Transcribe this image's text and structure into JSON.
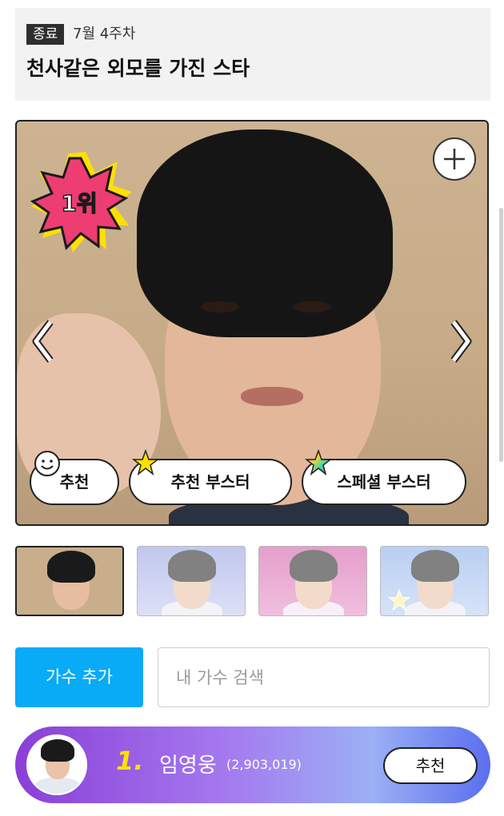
{
  "header": {
    "status_badge": "종료",
    "week": "7월 4주차",
    "title": "천사같은 외모를 가진 스타"
  },
  "photo": {
    "rank_label": "1위",
    "zoom_icon": "plus-icon",
    "prev_icon": "chevron-left-icon",
    "next_icon": "chevron-right-icon"
  },
  "vote_buttons": {
    "recommend": "추천",
    "recommend_booster": "추천 부스터",
    "special_booster": "스페셜 부스터"
  },
  "actions": {
    "add_singer": "가수 추가",
    "search_placeholder": "내 가수 검색"
  },
  "ranking": {
    "rank": "1.",
    "name": "임영웅",
    "votes": "(2,903,019)",
    "recommend": "추천"
  },
  "colors": {
    "accent_blue": "#09aaf6",
    "rank_badge_pink": "#ee3d73",
    "rank_badge_yellow": "#ffe000",
    "row_gradient_start": "#8a3fd6",
    "row_gradient_end": "#5b6ef0"
  }
}
